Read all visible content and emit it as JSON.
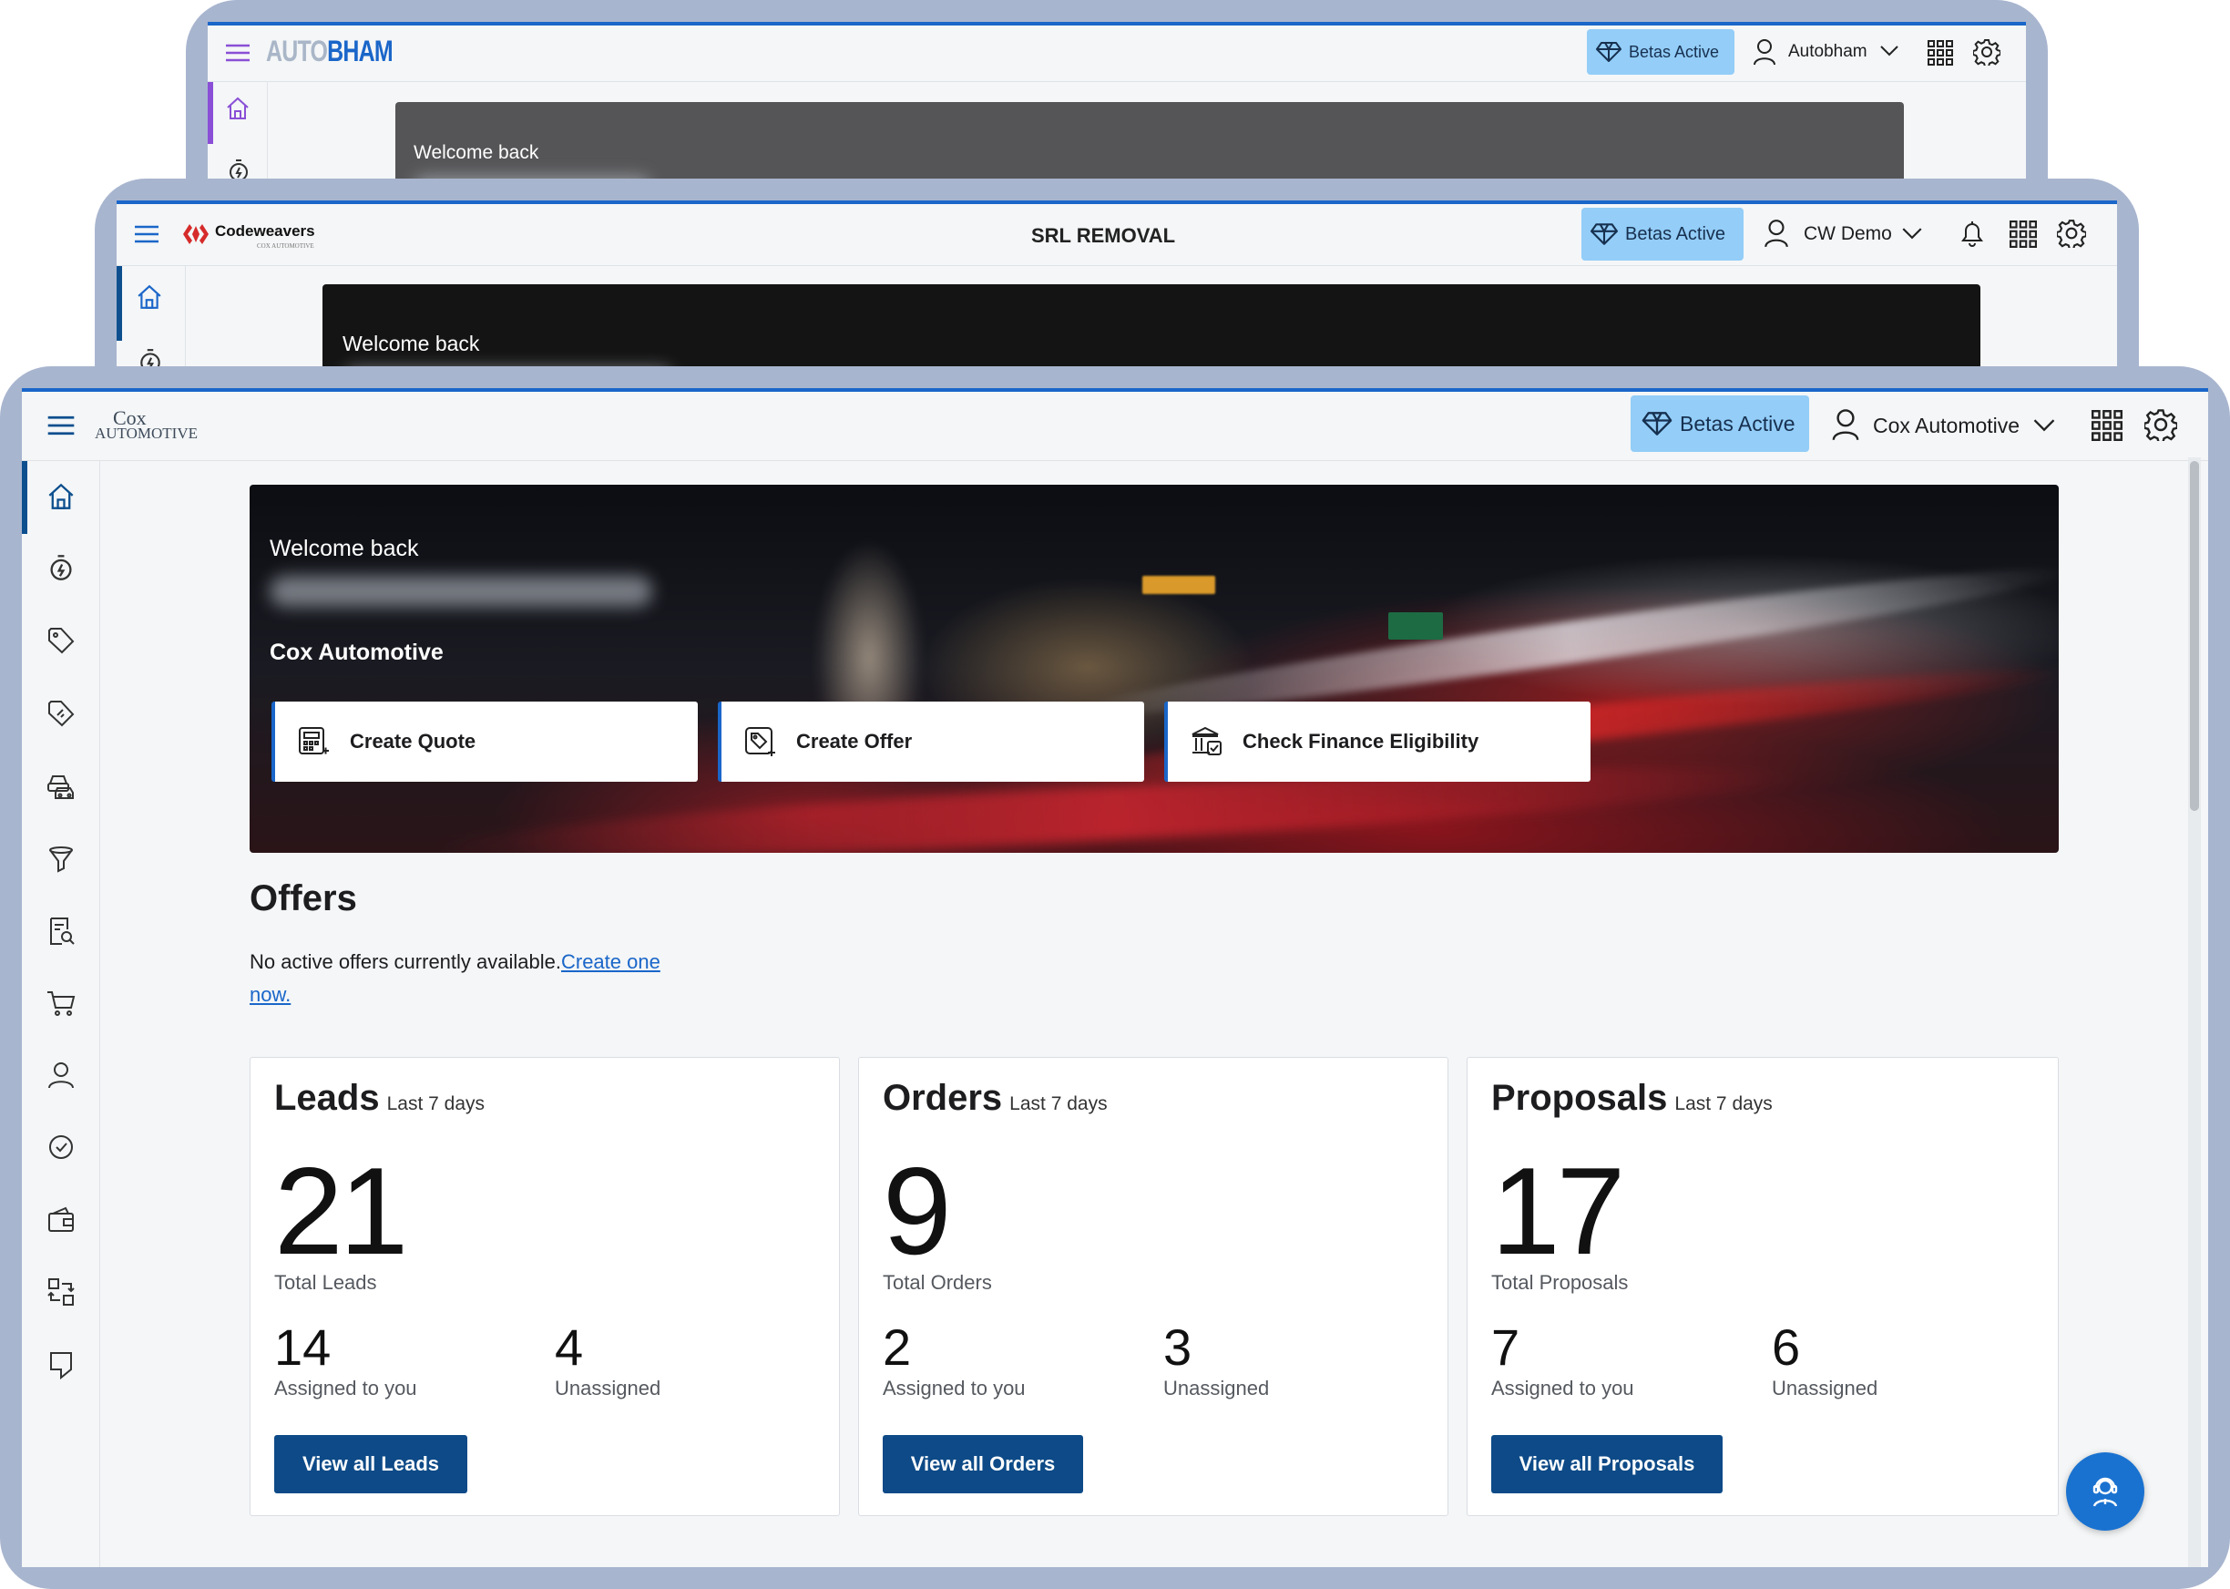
{
  "colors": {
    "frame": "#a8b5cf",
    "accent_blue": "#1a66c9",
    "button_navy": "#0d4a87",
    "beta_badge": "#93cdf8",
    "autobham_purple": "#8a4fd6"
  },
  "back_window": {
    "logo": {
      "part1": "AUTO",
      "part2": "BHAM"
    },
    "beta_label": "Betas Active",
    "account": "Autobham",
    "banner_greeting": "Welcome back",
    "icons": [
      "hamburger-icon",
      "home-icon",
      "stopwatch-icon",
      "diamond-icon",
      "user-icon",
      "chevron-down-icon",
      "apps-grid-icon",
      "gear-icon"
    ]
  },
  "middle_window": {
    "logo_name": "Codeweavers",
    "logo_tag": "COX AUTOMOTIVE",
    "page_title": "SRL REMOVAL",
    "beta_label": "Betas Active",
    "account": "CW Demo",
    "banner_greeting": "Welcome back",
    "icons": [
      "hamburger-icon",
      "home-icon",
      "stopwatch-icon",
      "diamond-icon",
      "user-icon",
      "chevron-down-icon",
      "bell-icon",
      "apps-grid-icon",
      "gear-icon"
    ]
  },
  "front_window": {
    "logo": {
      "line1": "Cox",
      "line2": "AUTOMOTIVE"
    },
    "beta_label": "Betas Active",
    "account": "Cox Automotive",
    "sidebar_icons": [
      "home-icon",
      "stopwatch-icon",
      "tag-icon",
      "wrench-tag-icon",
      "cars-icon",
      "funnel-icon",
      "report-search-icon",
      "cart-icon",
      "users-icon",
      "badge-check-icon",
      "wallet-icon",
      "swap-icon",
      "map-pin-icon"
    ],
    "hero": {
      "greeting": "Welcome back",
      "company": "Cox Automotive",
      "actions": [
        {
          "label": "Create Quote",
          "icon": "calculator-icon"
        },
        {
          "label": "Create Offer",
          "icon": "tag-plus-icon"
        },
        {
          "label": "Check Finance Eligibility",
          "icon": "bank-icon"
        }
      ]
    },
    "offers": {
      "heading": "Offers",
      "empty_text": "No active offers currently available.",
      "link_part1": "Create one",
      "link_part2": "now."
    },
    "cards": [
      {
        "title": "Leads",
        "period": "Last 7 days",
        "total": "21",
        "total_label": "Total Leads",
        "assigned": "14",
        "assigned_label": "Assigned to you",
        "unassigned": "4",
        "unassigned_label": "Unassigned",
        "button": "View all Leads"
      },
      {
        "title": "Orders",
        "period": "Last 7 days",
        "total": "9",
        "total_label": "Total Orders",
        "assigned": "2",
        "assigned_label": "Assigned to you",
        "unassigned": "3",
        "unassigned_label": "Unassigned",
        "button": "View all Orders"
      },
      {
        "title": "Proposals",
        "period": "Last 7 days",
        "total": "17",
        "total_label": "Total Proposals",
        "assigned": "7",
        "assigned_label": "Assigned to you",
        "unassigned": "6",
        "unassigned_label": "Unassigned",
        "button": "View all Proposals"
      }
    ],
    "fab_icon": "support-agent-icon"
  }
}
